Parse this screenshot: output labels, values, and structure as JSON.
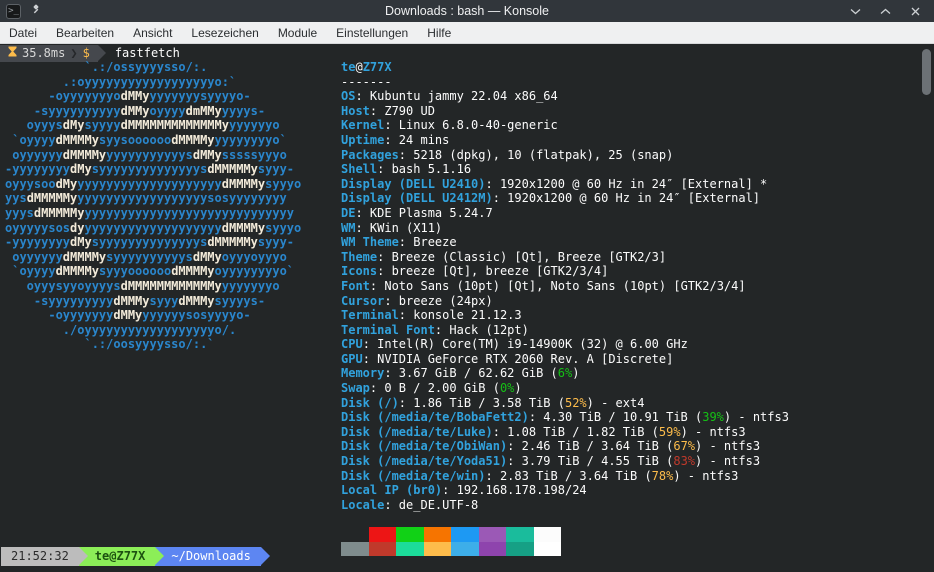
{
  "window": {
    "title": "Downloads : bash — Konsole"
  },
  "menu": {
    "items": [
      "Datei",
      "Bearbeiten",
      "Ansicht",
      "Lesezeichen",
      "Module",
      "Einstellungen",
      "Hilfe"
    ]
  },
  "terminal": {
    "prompt": {
      "duration": "35.8ms",
      "chevron": "❯",
      "symbol": "$",
      "command": "fastfetch"
    },
    "ascii_art": {
      "lines": [
        [
          [
            "b",
            "           `.:/ossyyyysso/:."
          ]
        ],
        [
          [
            "b",
            "        .:oyyyyyyyyyyyyyyyyyyo:`"
          ]
        ],
        [
          [
            "b",
            "      -oyyyyyyyo"
          ],
          [
            "w",
            "dMMy"
          ],
          [
            "b",
            "yyyyyyysyyyyo-"
          ]
        ],
        [
          [
            "b",
            "    -syyyyyyyyyy"
          ],
          [
            "w",
            "dMMy"
          ],
          [
            "b",
            "oyyyy"
          ],
          [
            "w",
            "dmMMy"
          ],
          [
            "b",
            "yyyys-"
          ]
        ],
        [
          [
            "b",
            "   oyyys"
          ],
          [
            "w",
            "dMy"
          ],
          [
            "b",
            "syyyy"
          ],
          [
            "w",
            "dMMMMMMMMMMMMMy"
          ],
          [
            "b",
            "yyyyyyo"
          ]
        ],
        [
          [
            "b",
            " `oyyyy"
          ],
          [
            "w",
            "dMMMMy"
          ],
          [
            "b",
            "syysoooooo"
          ],
          [
            "w",
            "dMMMMy"
          ],
          [
            "b",
            "yyyyyyyyo`"
          ]
        ],
        [
          [
            "b",
            " oyyyyyy"
          ],
          [
            "w",
            "dMMMMy"
          ],
          [
            "b",
            "yyyyyyyyyyys"
          ],
          [
            "w",
            "dMMy"
          ],
          [
            "b",
            "sssssyyyo"
          ]
        ],
        [
          [
            "b",
            "-yyyyyyyy"
          ],
          [
            "w",
            "dMy"
          ],
          [
            "b",
            "syyyyyyyyyyyyyys"
          ],
          [
            "w",
            "dMMMMMy"
          ],
          [
            "b",
            "syyy-"
          ]
        ],
        [
          [
            "b",
            "oyyysoo"
          ],
          [
            "w",
            "dMy"
          ],
          [
            "b",
            "yyyyyyyyyyyyyyyyyyyy"
          ],
          [
            "w",
            "dMMMMy"
          ],
          [
            "b",
            "syyyo"
          ]
        ],
        [
          [
            "b",
            "yys"
          ],
          [
            "w",
            "dMMMMMy"
          ],
          [
            "b",
            "yyyyyyyyyyyyyyyyyysosyyyyyyyy"
          ]
        ],
        [
          [
            "b",
            "yyys"
          ],
          [
            "w",
            "dMMMMMy"
          ],
          [
            "b",
            "yyyyyyyyyyyyyyyyyyyyyyyyyyyyy"
          ]
        ],
        [
          [
            "b",
            "oyyyyysos"
          ],
          [
            "w",
            "dy"
          ],
          [
            "b",
            "yyyyyyyyyyyyyyyyyyy"
          ],
          [
            "w",
            "dMMMMy"
          ],
          [
            "b",
            "syyyo"
          ]
        ],
        [
          [
            "b",
            "-yyyyyyyy"
          ],
          [
            "w",
            "dMy"
          ],
          [
            "b",
            "syyyyyyyyyyyyyys"
          ],
          [
            "w",
            "dMMMMMy"
          ],
          [
            "b",
            "syyy-"
          ]
        ],
        [
          [
            "b",
            " oyyyyyy"
          ],
          [
            "w",
            "dMMMMy"
          ],
          [
            "b",
            "syyyyyyyyyys"
          ],
          [
            "w",
            "dMMy"
          ],
          [
            "b",
            "oyyyoyyyo"
          ]
        ],
        [
          [
            "b",
            " `oyyyy"
          ],
          [
            "w",
            "dMMMMy"
          ],
          [
            "b",
            "syyyoooooo"
          ],
          [
            "w",
            "dMMMMy"
          ],
          [
            "b",
            "oyyyyyyyyo`"
          ]
        ],
        [
          [
            "b",
            "   oyyysyyoyyyys"
          ],
          [
            "w",
            "dMMMMMMMMMMMMy"
          ],
          [
            "b",
            "yyyyyyyo"
          ]
        ],
        [
          [
            "b",
            "    -syyyyyyyyy"
          ],
          [
            "w",
            "dMMMy"
          ],
          [
            "b",
            "syyy"
          ],
          [
            "w",
            "dMMMy"
          ],
          [
            "b",
            "syyyys-"
          ]
        ],
        [
          [
            "b",
            "      -oyyyyyyy"
          ],
          [
            "w",
            "dMMy"
          ],
          [
            "b",
            "yyyyyysosyyyyo-"
          ]
        ],
        [
          [
            "b",
            "        ./oyyyyyyyyyyyyyyyyyyo/."
          ]
        ],
        [
          [
            "b",
            "           `.:/oosyyyysso/:.`"
          ]
        ]
      ]
    },
    "info_lines": [
      [
        [
          "blue",
          "te"
        ],
        [
          "white",
          "@"
        ],
        [
          "blue",
          "Z77X"
        ]
      ],
      [
        [
          "white",
          "-------"
        ]
      ],
      [
        [
          "blue",
          "OS"
        ],
        [
          "white",
          ": Kubuntu jammy 22.04 x86_64"
        ]
      ],
      [
        [
          "blue",
          "Host"
        ],
        [
          "white",
          ": Z790 UD"
        ]
      ],
      [
        [
          "blue",
          "Kernel"
        ],
        [
          "white",
          ": Linux 6.8.0-40-generic"
        ]
      ],
      [
        [
          "blue",
          "Uptime"
        ],
        [
          "white",
          ": 24 mins"
        ]
      ],
      [
        [
          "blue",
          "Packages"
        ],
        [
          "white",
          ": 5218 (dpkg), 10 (flatpak), 25 (snap)"
        ]
      ],
      [
        [
          "blue",
          "Shell"
        ],
        [
          "white",
          ": bash 5.1.16"
        ]
      ],
      [
        [
          "blue",
          "Display (DELL U2410)"
        ],
        [
          "white",
          ": 1920x1200 @ 60 Hz in 24″ [External] *"
        ]
      ],
      [
        [
          "blue",
          "Display (DELL U2412M)"
        ],
        [
          "white",
          ": 1920x1200 @ 60 Hz in 24″ [External]"
        ]
      ],
      [
        [
          "blue",
          "DE"
        ],
        [
          "white",
          ": KDE Plasma 5.24.7"
        ]
      ],
      [
        [
          "blue",
          "WM"
        ],
        [
          "white",
          ": KWin (X11)"
        ]
      ],
      [
        [
          "blue",
          "WM Theme"
        ],
        [
          "white",
          ": Breeze"
        ]
      ],
      [
        [
          "blue",
          "Theme"
        ],
        [
          "white",
          ": Breeze (Classic) [Qt], Breeze [GTK2/3]"
        ]
      ],
      [
        [
          "blue",
          "Icons"
        ],
        [
          "white",
          ": breeze [Qt], breeze [GTK2/3/4]"
        ]
      ],
      [
        [
          "blue",
          "Font"
        ],
        [
          "white",
          ": Noto Sans (10pt) [Qt], Noto Sans (10pt) [GTK2/3/4]"
        ]
      ],
      [
        [
          "blue",
          "Cursor"
        ],
        [
          "white",
          ": breeze (24px)"
        ]
      ],
      [
        [
          "blue",
          "Terminal"
        ],
        [
          "white",
          ": konsole 21.12.3"
        ]
      ],
      [
        [
          "blue",
          "Terminal Font"
        ],
        [
          "white",
          ": Hack (12pt)"
        ]
      ],
      [
        [
          "blue",
          "CPU"
        ],
        [
          "white",
          ": Intel(R) Core(TM) i9-14900K (32) @ 6.00 GHz"
        ]
      ],
      [
        [
          "blue",
          "GPU"
        ],
        [
          "white",
          ": NVIDIA GeForce RTX 2060 Rev. A [Discrete]"
        ]
      ],
      [
        [
          "blue",
          "Memory"
        ],
        [
          "white",
          ": 3.67 GiB / 62.62 GiB ("
        ],
        [
          "green",
          "6%"
        ],
        [
          "white",
          ")"
        ]
      ],
      [
        [
          "blue",
          "Swap"
        ],
        [
          "white",
          ": 0 B / 2.00 GiB ("
        ],
        [
          "green",
          "0%"
        ],
        [
          "white",
          ")"
        ]
      ],
      [
        [
          "blue",
          "Disk (/)"
        ],
        [
          "white",
          ": 1.86 TiB / 3.58 TiB ("
        ],
        [
          "yellow",
          "52%"
        ],
        [
          "white",
          ") - ext4"
        ]
      ],
      [
        [
          "blue",
          "Disk (/media/te/BobaFett2)"
        ],
        [
          "white",
          ": 4.30 TiB / 10.91 TiB ("
        ],
        [
          "green",
          "39%"
        ],
        [
          "white",
          ") - ntfs3"
        ]
      ],
      [
        [
          "blue",
          "Disk (/media/te/Luke)"
        ],
        [
          "white",
          ": 1.08 TiB / 1.82 TiB ("
        ],
        [
          "yellow",
          "59%"
        ],
        [
          "white",
          ") - ntfs3"
        ]
      ],
      [
        [
          "blue",
          "Disk (/media/te/ObiWan)"
        ],
        [
          "white",
          ": 2.46 TiB / 3.64 TiB ("
        ],
        [
          "yellow",
          "67%"
        ],
        [
          "white",
          ") - ntfs3"
        ]
      ],
      [
        [
          "blue",
          "Disk (/media/te/Yoda51)"
        ],
        [
          "white",
          ": 3.79 TiB / 4.55 TiB ("
        ],
        [
          "red",
          "83%"
        ],
        [
          "white",
          ") - ntfs3"
        ]
      ],
      [
        [
          "blue",
          "Disk (/media/te/win)"
        ],
        [
          "white",
          ": 2.83 TiB / 3.64 TiB ("
        ],
        [
          "yellow",
          "78%"
        ],
        [
          "white",
          ") - ntfs3"
        ]
      ],
      [
        [
          "blue",
          "Local IP (br0)"
        ],
        [
          "white",
          ": 192.168.178.198/24"
        ]
      ],
      [
        [
          "blue",
          "Locale"
        ],
        [
          "white",
          ": de_DE.UTF-8"
        ]
      ]
    ],
    "palette": {
      "row1": [
        "#232627",
        "#ed1515",
        "#11d116",
        "#f67400",
        "#1d99f3",
        "#9b59b6",
        "#1abc9c",
        "#fcfcfc"
      ],
      "row2": [
        "#7f8c8d",
        "#c0392b",
        "#1cdc9a",
        "#fdbc4b",
        "#3daee9",
        "#8e44ad",
        "#16a085",
        "#ffffff"
      ]
    },
    "statusbar": {
      "time": "21:52:32",
      "user_host": "te@Z77X",
      "path": "~/Downloads"
    }
  },
  "colors": {
    "titlebar_bg": "#31363b",
    "menubar_bg": "#eff0f1",
    "terminal_bg": "#232627",
    "label_blue": "#31a2dd",
    "art_blue": "#2a86cc",
    "value_white": "#fcfcfc",
    "pct_green": "#15c115",
    "pct_yellow": "#fdbc4b",
    "pct_red": "#c0392b",
    "status_time_bg": "#bcbcbc",
    "status_user_bg": "#8cee58",
    "status_path_bg": "#5d86f2",
    "prompt_seg_bg": "#45484d"
  }
}
